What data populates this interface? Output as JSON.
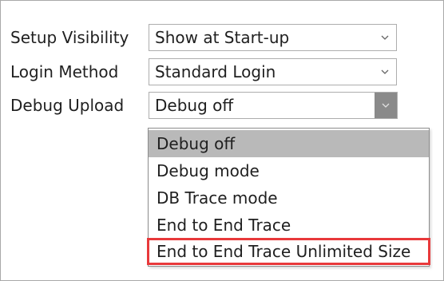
{
  "form": {
    "rows": [
      {
        "label": "Setup Visibility",
        "value": "Show at Start-up"
      },
      {
        "label": "Login Method",
        "value": "Standard Login"
      },
      {
        "label": "Debug Upload",
        "value": "Debug off"
      }
    ]
  },
  "dropdown": {
    "options": [
      {
        "label": "Debug off",
        "selected": true
      },
      {
        "label": "Debug mode"
      },
      {
        "label": "DB Trace mode"
      },
      {
        "label": "End to End Trace"
      },
      {
        "label": "End to End Trace Unlimited Size",
        "highlighted": true
      }
    ]
  },
  "colors": {
    "highlight_border": "#e8393b",
    "selected_bg": "#b9b9b9",
    "open_arrow_bg": "#8a8a8a"
  },
  "icons": {
    "dropdown_arrow": "chevron-down-icon"
  }
}
